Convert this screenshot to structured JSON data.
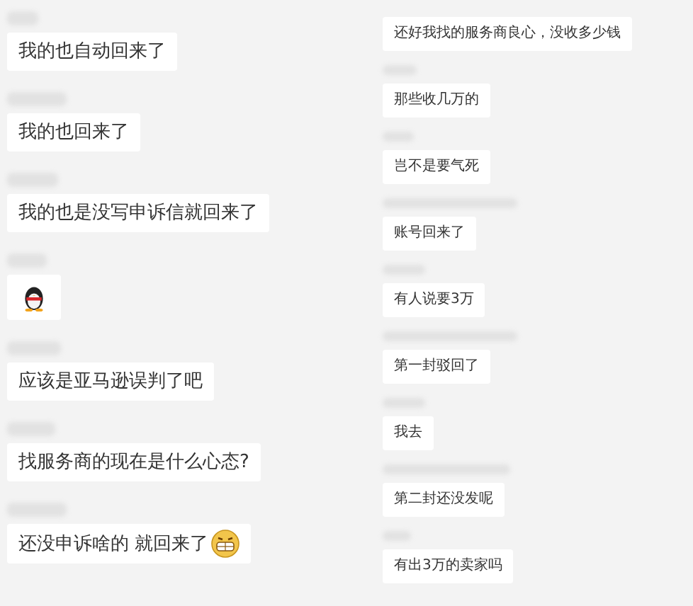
{
  "left_messages": [
    {
      "kind": "text",
      "text": "我的也自动回来了",
      "trailing_emoji": false
    },
    {
      "kind": "text",
      "text": "我的也回来了",
      "trailing_emoji": false
    },
    {
      "kind": "text",
      "text": "我的也是没写申诉信就回来了",
      "trailing_emoji": false
    },
    {
      "kind": "sticker"
    },
    {
      "kind": "text",
      "text": "应该是亚马逊误判了吧",
      "trailing_emoji": false
    },
    {
      "kind": "text",
      "text": "找服务商的现在是什么心态?",
      "trailing_emoji": false
    },
    {
      "kind": "text",
      "text": "还没申诉啥的 就回来了",
      "trailing_emoji": true
    }
  ],
  "right_messages": [
    {
      "text": "还好我找的服务商良心，没收多少钱"
    },
    {
      "text": "那些收几万的"
    },
    {
      "text": "岂不是要气死"
    },
    {
      "text": "账号回来了"
    },
    {
      "text": "有人说要3万"
    },
    {
      "text": "第一封驳回了"
    },
    {
      "text": "我去"
    },
    {
      "text": "第二封还没发呢"
    },
    {
      "text": "有出3万的卖家吗"
    }
  ]
}
